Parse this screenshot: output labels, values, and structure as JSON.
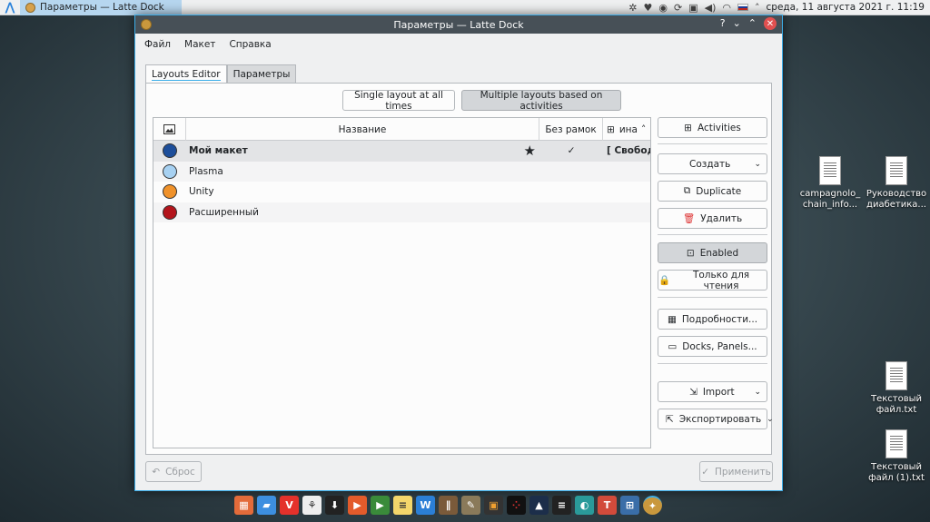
{
  "topbar": {
    "task_title": "Параметры — Latte Dock",
    "datetime": "среда, 11 августа 2021 г. 11:19"
  },
  "window": {
    "title": "Параметры — Latte Dock",
    "menu": [
      "Файл",
      "Макет",
      "Справка"
    ],
    "tabs": [
      "Layouts Editor",
      "Параметры"
    ],
    "mode_buttons": [
      "Single layout at all times",
      "Multiple layouts based on activities"
    ],
    "table": {
      "headers": [
        "Название",
        "Без рамок",
        "ина"
      ],
      "rows": [
        {
          "name": "Мой макет",
          "color": "#1d4e9a",
          "star": "★",
          "borderless": "✓",
          "activity": "[ Свободно",
          "selected": true
        },
        {
          "name": "Plasma",
          "color": "#a7d1f2",
          "star": "",
          "borderless": "",
          "activity": ""
        },
        {
          "name": "Unity",
          "color": "#f0922b",
          "star": "",
          "borderless": "",
          "activity": ""
        },
        {
          "name": "Расширенный",
          "color": "#b3151c",
          "star": "",
          "borderless": "",
          "activity": ""
        }
      ]
    },
    "side_buttons": {
      "activities": "Activities",
      "create": "Создать",
      "duplicate": "Duplicate",
      "remove": "Удалить",
      "enabled": "Enabled",
      "readonly": "Только для чтения",
      "details": "Подробности...",
      "docks": "Docks, Panels...",
      "import": "Import",
      "export": "Экспортировать"
    },
    "reset": "Сброс",
    "apply": "Применить"
  },
  "desktop": {
    "icons": [
      "campagnolo_ chain_info...",
      "Руководство диабетика...",
      "Текстовый файл.txt",
      "Текстовый файл (1).txt"
    ]
  },
  "colors": {
    "accent": "#3daee9",
    "titlebar": "#475057"
  }
}
